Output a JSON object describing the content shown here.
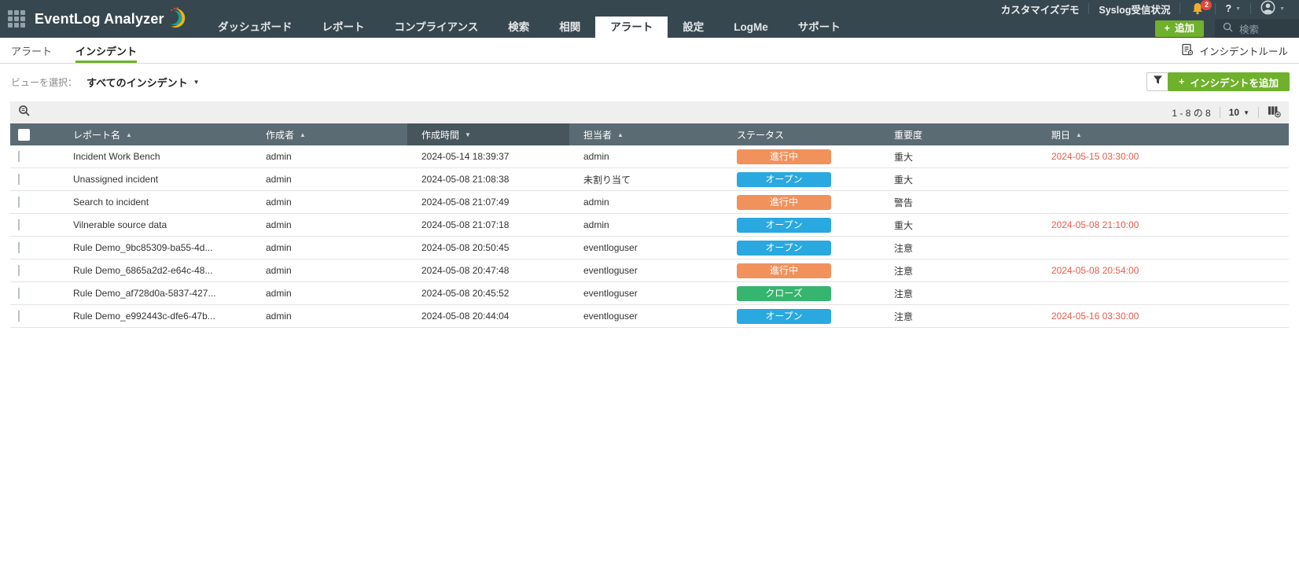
{
  "topbar": {
    "logo_text": "EventLog Analyzer",
    "nav": [
      {
        "label": "ダッシュボード",
        "active": false
      },
      {
        "label": "レポート",
        "active": false
      },
      {
        "label": "コンプライアンス",
        "active": false
      },
      {
        "label": "検索",
        "active": false
      },
      {
        "label": "相関",
        "active": false
      },
      {
        "label": "アラート",
        "active": true
      },
      {
        "label": "設定",
        "active": false
      },
      {
        "label": "LogMe",
        "active": false
      },
      {
        "label": "サポート",
        "active": false
      }
    ],
    "customize_demo": "カスタマイズデモ",
    "syslog_status": "Syslog受信状況",
    "notification_count": "2",
    "help_label": "?",
    "add_button": "追加",
    "search_placeholder": "検索"
  },
  "subtabs": {
    "alert": "アラート",
    "incident": "インシデント",
    "incident_rules": "インシデントルール"
  },
  "viewbar": {
    "label": "ビューを選択：",
    "selected_view": "すべてのインシデント",
    "add_incident": "インシデントを追加"
  },
  "toolbar": {
    "range": "1 - 8 の 8",
    "page_size": "10"
  },
  "table": {
    "columns": [
      {
        "label": "レポート名",
        "arrow": "▲"
      },
      {
        "label": "作成者",
        "arrow": "▲"
      },
      {
        "label": "作成時間",
        "arrow": "▼"
      },
      {
        "label": "担当者",
        "arrow": "▲"
      },
      {
        "label": "ステータス",
        "arrow": ""
      },
      {
        "label": "重要度",
        "arrow": ""
      },
      {
        "label": "期日",
        "arrow": "▲"
      }
    ],
    "rows": [
      {
        "name": "Incident Work Bench",
        "creator": "admin",
        "created": "2024-05-14 18:39:37",
        "assignee": "admin",
        "status": "進行中",
        "severity": "重大",
        "due": "2024-05-15 03:30:00"
      },
      {
        "name": "Unassigned incident",
        "creator": "admin",
        "created": "2024-05-08 21:08:38",
        "assignee": "未割り当て",
        "status": "オープン",
        "severity": "重大",
        "due": ""
      },
      {
        "name": "Search to incident",
        "creator": "admin",
        "created": "2024-05-08 21:07:49",
        "assignee": "admin",
        "status": "進行中",
        "severity": "警告",
        "due": ""
      },
      {
        "name": "Vilnerable source data",
        "creator": "admin",
        "created": "2024-05-08 21:07:18",
        "assignee": "admin",
        "status": "オープン",
        "severity": "重大",
        "due": "2024-05-08 21:10:00"
      },
      {
        "name": "Rule Demo_9bc85309-ba55-4d...",
        "creator": "admin",
        "created": "2024-05-08 20:50:45",
        "assignee": "eventloguser",
        "status": "オープン",
        "severity": "注意",
        "due": ""
      },
      {
        "name": "Rule Demo_6865a2d2-e64c-48...",
        "creator": "admin",
        "created": "2024-05-08 20:47:48",
        "assignee": "eventloguser",
        "status": "進行中",
        "severity": "注意",
        "due": "2024-05-08 20:54:00"
      },
      {
        "name": "Rule Demo_af728d0a-5837-427...",
        "creator": "admin",
        "created": "2024-05-08 20:45:52",
        "assignee": "eventloguser",
        "status": "クローズ",
        "severity": "注意",
        "due": ""
      },
      {
        "name": "Rule Demo_e992443c-dfe6-47b...",
        "creator": "admin",
        "created": "2024-05-08 20:44:04",
        "assignee": "eventloguser",
        "status": "オープン",
        "severity": "注意",
        "due": "2024-05-16 03:30:00"
      }
    ],
    "status_colors": {
      "オープン": "#2aa8e0",
      "進行中": "#f1915c",
      "クローズ": "#35b56d"
    }
  },
  "icons": {
    "plus": "+",
    "caret_down": "▼"
  },
  "colors": {
    "accent_green": "#6fb12c",
    "due_red": "#eb5a47",
    "topbar_bg": "#37474f"
  }
}
